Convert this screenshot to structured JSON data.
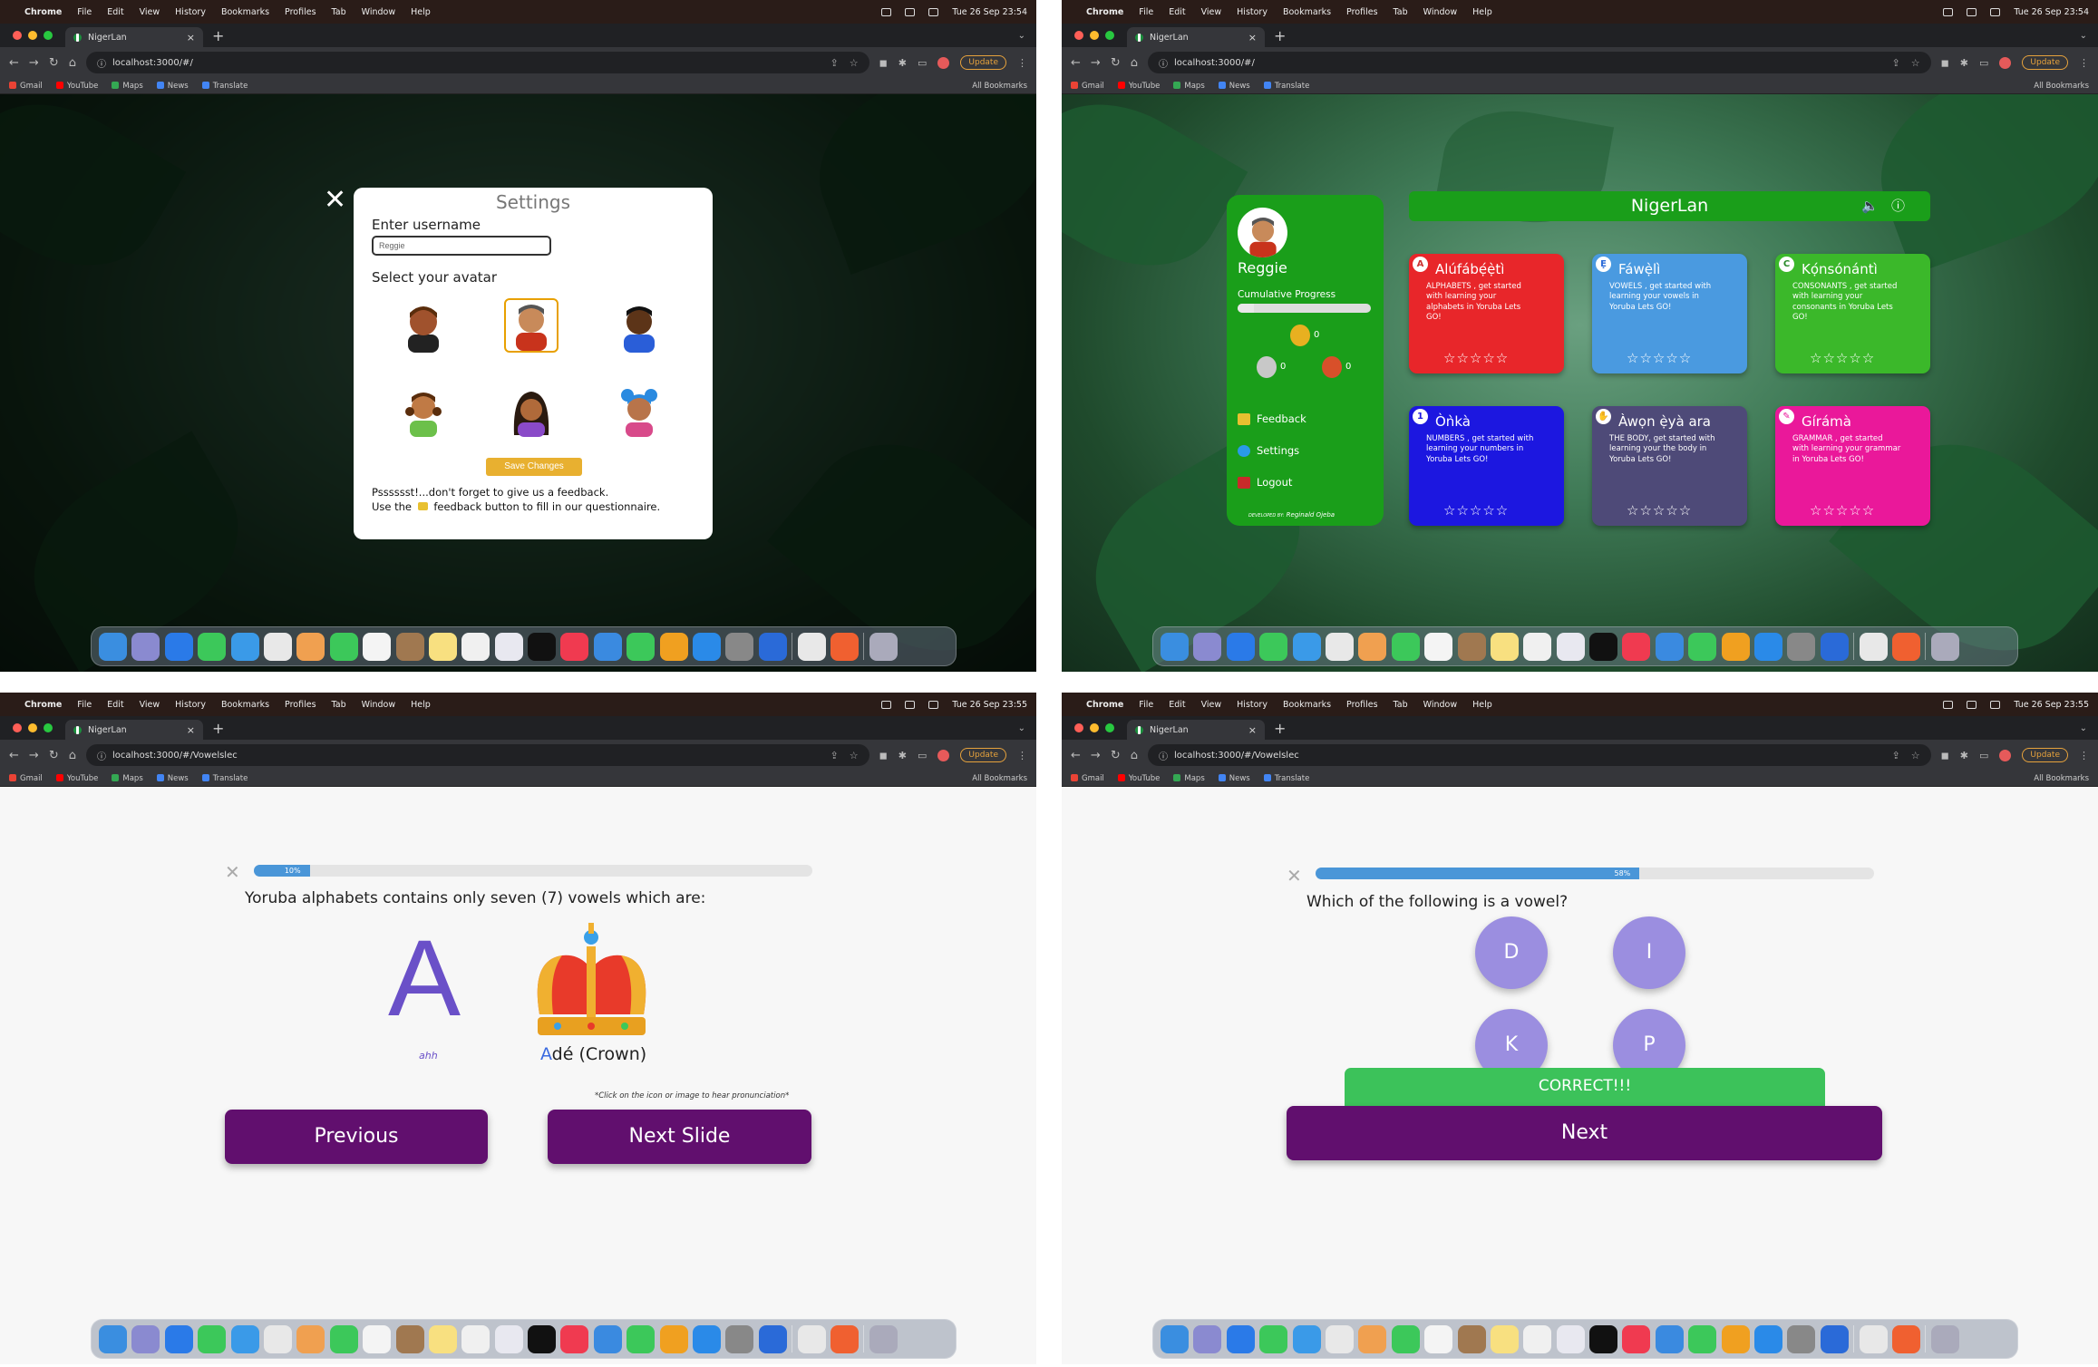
{
  "menubar": {
    "app": "Chrome",
    "items": [
      "File",
      "Edit",
      "View",
      "History",
      "Bookmarks",
      "Profiles",
      "Tab",
      "Window",
      "Help"
    ]
  },
  "screens": [
    {
      "clock": "Tue 26 Sep  23:54",
      "tab_title": "NigerLan",
      "url": "localhost:3000/#/"
    },
    {
      "clock": "Tue 26 Sep  23:54",
      "tab_title": "NigerLan",
      "url": "localhost:3000/#/"
    },
    {
      "clock": "Tue 26 Sep  23:55",
      "tab_title": "NigerLan",
      "url": "localhost:3000/#/Vowelslec"
    },
    {
      "clock": "Tue 26 Sep  23:55",
      "tab_title": "NigerLan",
      "url": "localhost:3000/#/Vowelslec"
    }
  ],
  "toolbar": {
    "update_label": "Update"
  },
  "bookmarks": {
    "items": [
      "Gmail",
      "YouTube",
      "Maps",
      "News",
      "Translate"
    ],
    "all": "All Bookmarks"
  },
  "dashboard": {
    "app_title": "NigerLan",
    "username": "Reggie",
    "progress_label": "Cumulative Progress",
    "progress": 0.12,
    "medals": {
      "gold": "0",
      "silver": "0",
      "bronze": "0"
    },
    "menu": {
      "feedback": "Feedback",
      "settings": "Settings",
      "logout": "Logout"
    },
    "dev_prefix": "DEVELOPED BY:",
    "dev_name": "Reginald Ojeba",
    "stars": "☆☆☆☆☆",
    "cards": [
      {
        "icon": "A",
        "title": "Alúfábẹ́ẹ̀tì",
        "desc": "ALPHABETS , get started with learning your alphabets in Yoruba Lets GO!",
        "color": "#e8262a"
      },
      {
        "icon": "Ẹ",
        "title": "Fáwẹ̀lì",
        "desc": "VOWELS , get started with learning your vowels in Yoruba Lets GO!",
        "color": "#4a9ae0"
      },
      {
        "icon": "C",
        "title": "Kọ́nsónántì",
        "desc": "CONSONANTS , get started with learning your consonants in Yoruba Lets GO!",
        "color": "#3bb82a"
      },
      {
        "icon": "1",
        "title": "Òǹkà",
        "desc": "NUMBERS , get started with learning your numbers in Yoruba Lets GO!",
        "color": "#1c17e0"
      },
      {
        "icon": "✋",
        "title": "Àwọn ẹ̀yà ara",
        "desc": "THE BODY, get started with learning your the body in Yoruba Lets GO!",
        "color": "#4e4a78"
      },
      {
        "icon": "✎",
        "title": "Gírámà",
        "desc": "GRAMMAR , get started with learning your grammar in Yoruba Lets GO!",
        "color": "#ea189a"
      }
    ]
  },
  "settings": {
    "title": "Settings",
    "username_label": "Enter username",
    "username_value": "Reggie",
    "avatar_label": "Select your avatar",
    "save_label": "Save Changes",
    "feedback_line1": "Psssssst!...don't forget to give us a feedback.",
    "feedback_line2_a": "Use the",
    "feedback_line2_b": "feedback button to fill in our questionnaire."
  },
  "lesson": {
    "progress_label": "10%",
    "progress": 0.1,
    "text": "Yoruba alphabets contains only seven (7) vowels which are:",
    "letter": "A",
    "pronunciation": "ahh",
    "word_first": "A",
    "word_rest": "dé (Crown)",
    "hint": "*Click on the icon or image to hear pronunciation*",
    "prev_label": "Previous",
    "next_label": "Next Slide"
  },
  "quiz": {
    "progress_label": "58%",
    "progress": 0.58,
    "question": "Which of the following is a vowel?",
    "options": [
      "D",
      "I",
      "K",
      "P"
    ],
    "feedback": "CORRECT!!!",
    "next_label": "Next"
  },
  "colors": {
    "panel_green": "#1a9e1a",
    "button_purple": "#610f6e",
    "option_purple": "#9b8ee0",
    "correct_green": "#3cc25a",
    "progress_blue": "#4a96d8"
  }
}
